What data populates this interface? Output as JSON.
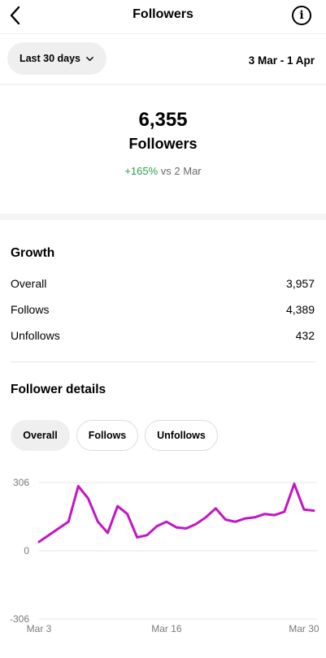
{
  "header": {
    "title": "Followers",
    "back_icon": "chevron-left-icon",
    "info_icon": "info-icon",
    "info_glyph": "i"
  },
  "range": {
    "selected": "Last 30 days",
    "dates": "3 Mar - 1 Apr"
  },
  "summary": {
    "count": "6,355",
    "label": "Followers",
    "change_value": "+165%",
    "change_suffix": " vs 2 Mar",
    "change_color": "#2e9d4c"
  },
  "growth": {
    "title": "Growth",
    "rows": [
      {
        "label": "Overall",
        "value": "3,957"
      },
      {
        "label": "Follows",
        "value": "4,389"
      },
      {
        "label": "Unfollows",
        "value": "432"
      }
    ]
  },
  "details": {
    "title": "Follower details",
    "tabs": [
      {
        "label": "Overall",
        "active": true
      },
      {
        "label": "Follows",
        "active": false
      },
      {
        "label": "Unfollows",
        "active": false
      }
    ]
  },
  "chart_data": {
    "type": "line",
    "color": "#c316c3",
    "x": [
      "Mar 3",
      "Mar 4",
      "Mar 5",
      "Mar 6",
      "Mar 7",
      "Mar 8",
      "Mar 9",
      "Mar 10",
      "Mar 11",
      "Mar 12",
      "Mar 13",
      "Mar 14",
      "Mar 15",
      "Mar 16",
      "Mar 17",
      "Mar 18",
      "Mar 19",
      "Mar 20",
      "Mar 21",
      "Mar 22",
      "Mar 23",
      "Mar 24",
      "Mar 25",
      "Mar 26",
      "Mar 27",
      "Mar 28",
      "Mar 29",
      "Mar 30",
      "Mar 31"
    ],
    "series": [
      {
        "values": [
          40,
          70,
          100,
          130,
          290,
          235,
          130,
          80,
          200,
          165,
          60,
          70,
          110,
          130,
          105,
          100,
          120,
          150,
          190,
          140,
          130,
          145,
          150,
          165,
          160,
          175,
          300,
          185,
          180
        ]
      }
    ],
    "ylim": [
      -306,
      306
    ],
    "yticks": [
      "306",
      "0",
      "-306"
    ],
    "xticks": [
      {
        "label": "Mar 3",
        "index": 0
      },
      {
        "label": "Mar 16",
        "index": 13
      },
      {
        "label": "Mar 30",
        "index": 27
      }
    ],
    "grid": true
  }
}
